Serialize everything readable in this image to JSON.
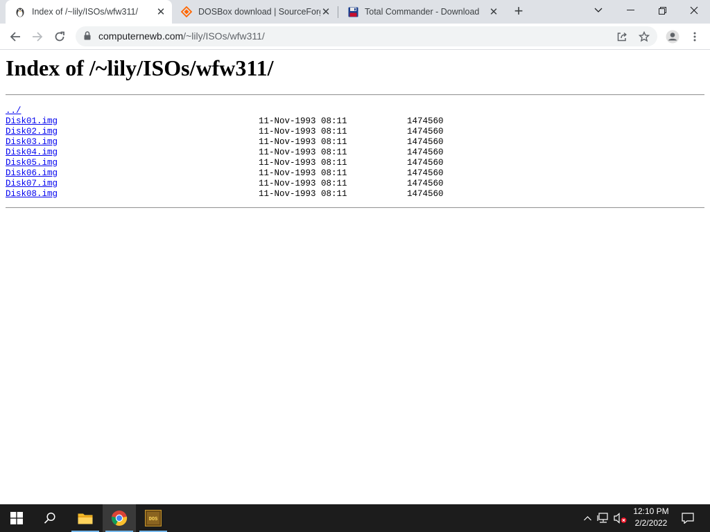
{
  "browser": {
    "tabs": [
      {
        "title": "Index of /~lily/ISOs/wfw311/",
        "favicon": "linux-penguin-icon",
        "active": true
      },
      {
        "title": "DOSBox download | SourceForge",
        "favicon": "sourceforge-diamond-icon",
        "active": false
      },
      {
        "title": "Total Commander - Download",
        "favicon": "floppy-disk-icon",
        "active": false
      }
    ],
    "address": {
      "domain": "computernewb.com",
      "path": "/~lily/ISOs/wfw311/"
    }
  },
  "page": {
    "heading": "Index of /~lily/ISOs/wfw311/",
    "parent_link": "../",
    "entries": [
      {
        "name": "Disk01.img",
        "date": "11-Nov-1993 08:11",
        "size": "1474560"
      },
      {
        "name": "Disk02.img",
        "date": "11-Nov-1993 08:11",
        "size": "1474560"
      },
      {
        "name": "Disk03.img",
        "date": "11-Nov-1993 08:11",
        "size": "1474560"
      },
      {
        "name": "Disk04.img",
        "date": "11-Nov-1993 08:11",
        "size": "1474560"
      },
      {
        "name": "Disk05.img",
        "date": "11-Nov-1993 08:11",
        "size": "1474560"
      },
      {
        "name": "Disk06.img",
        "date": "11-Nov-1993 08:11",
        "size": "1474560"
      },
      {
        "name": "Disk07.img",
        "date": "11-Nov-1993 08:11",
        "size": "1474560"
      },
      {
        "name": "Disk08.img",
        "date": "11-Nov-1993 08:11",
        "size": "1474560"
      }
    ]
  },
  "taskbar": {
    "apps": [
      "file-explorer",
      "google-chrome",
      "dosbox"
    ],
    "clock": {
      "time": "12:10 PM",
      "date": "2/2/2022"
    }
  },
  "colors": {
    "link": "#0000ee",
    "tabstrip": "#dee1e6",
    "taskbar": "#1c1c1c"
  }
}
